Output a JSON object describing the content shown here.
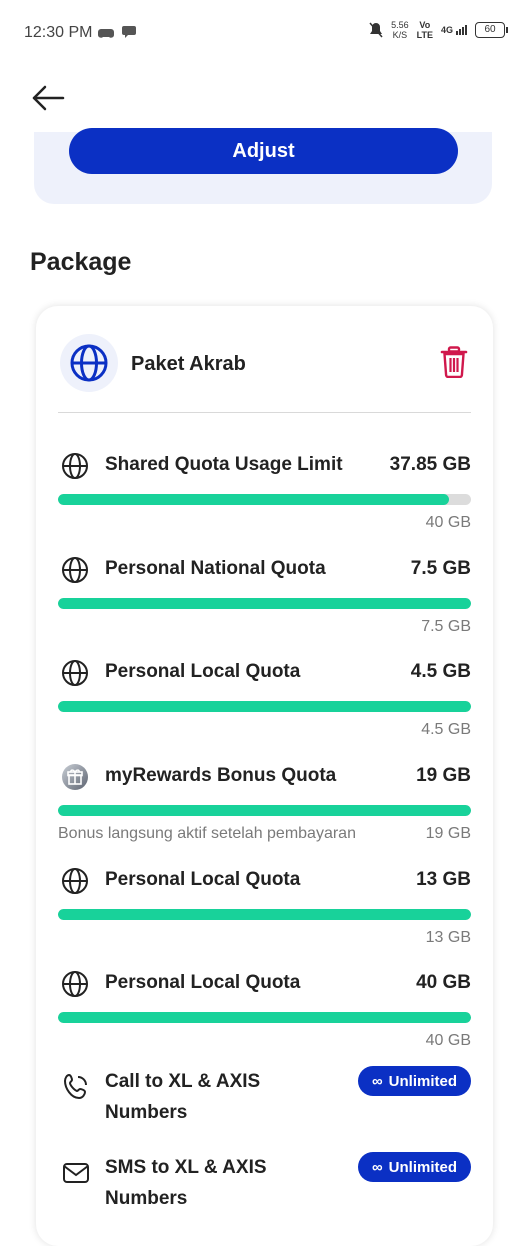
{
  "status_bar": {
    "time": "12:30 PM",
    "net_speed_value": "5.56",
    "net_speed_unit": "K/S",
    "volte_top": "Vo",
    "volte_bottom": "LTE",
    "network": "4G",
    "battery": "60"
  },
  "top_card": {
    "adjust_label": "Adjust"
  },
  "section_title": "Package",
  "package": {
    "name": "Paket Akrab",
    "quotas": [
      {
        "label": "Shared Quota Usage Limit",
        "value": "37.85 GB",
        "total": "40 GB",
        "fill_percent": 94.6,
        "icon": "globe-icon"
      },
      {
        "label": "Personal National Quota",
        "value": "7.5 GB",
        "total": "7.5 GB",
        "fill_percent": 100,
        "icon": "globe-icon"
      },
      {
        "label": "Personal Local Quota",
        "value": "4.5 GB",
        "total": "4.5 GB",
        "fill_percent": 100,
        "icon": "globe-icon"
      },
      {
        "label": "myRewards Bonus Quota",
        "value": "19 GB",
        "total": "19 GB",
        "note": "Bonus langsung aktif setelah pembayaran",
        "fill_percent": 100,
        "icon": "gift-icon"
      },
      {
        "label": "Personal Local Quota",
        "value": "13 GB",
        "total": "13 GB",
        "fill_percent": 100,
        "icon": "globe-icon"
      },
      {
        "label": "Personal Local Quota",
        "value": "40 GB",
        "total": "40 GB",
        "fill_percent": 100,
        "icon": "globe-icon"
      }
    ],
    "services": [
      {
        "label": "Call to  XL & AXIS Numbers",
        "badge": "Unlimited",
        "icon": "phone-icon"
      },
      {
        "label": "SMS to  XL & AXIS Numbers",
        "badge": "Unlimited",
        "icon": "mail-icon"
      }
    ]
  },
  "colors": {
    "primary": "#0b30c4",
    "progress": "#18d29a",
    "trash": "#d0184c"
  }
}
